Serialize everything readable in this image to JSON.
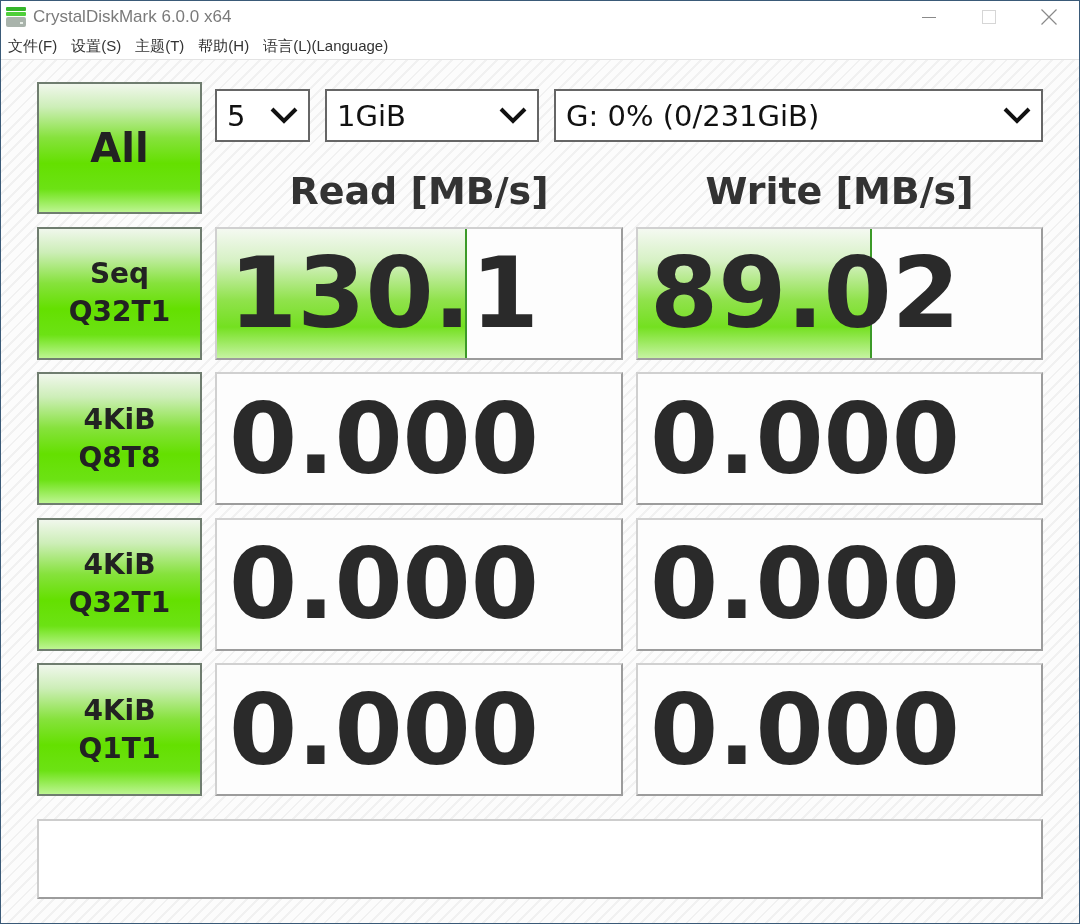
{
  "window": {
    "title": "CrystalDiskMark 6.0.0 x64",
    "maximize_disabled": true
  },
  "menu": [
    "文件(F)",
    "设置(S)",
    "主题(T)",
    "帮助(H)",
    "语言(L)(Language)"
  ],
  "all_button": {
    "label": "All"
  },
  "selectors": [
    {
      "value": "5"
    },
    {
      "value": "1GiB"
    },
    {
      "value": "G: 0% (0/231GiB)"
    }
  ],
  "columns": [
    "Read [MB/s]",
    "Write [MB/s]"
  ],
  "tests": [
    {
      "label": [
        "Seq",
        "Q32T1"
      ],
      "read": {
        "value": "130.1",
        "level": 0.62
      },
      "write": {
        "value": "89.02",
        "level": 0.58
      }
    },
    {
      "label": [
        "4KiB",
        "Q8T8"
      ],
      "read": {
        "value": "0.000"
      },
      "write": {
        "value": "0.000"
      }
    },
    {
      "label": [
        "4KiB",
        "Q32T1"
      ],
      "read": {
        "value": "0.000"
      },
      "write": {
        "value": "0.000"
      }
    },
    {
      "label": [
        "4KiB",
        "Q1T1"
      ],
      "read": {
        "value": "0.000"
      },
      "write": {
        "value": "0.000"
      }
    }
  ]
}
